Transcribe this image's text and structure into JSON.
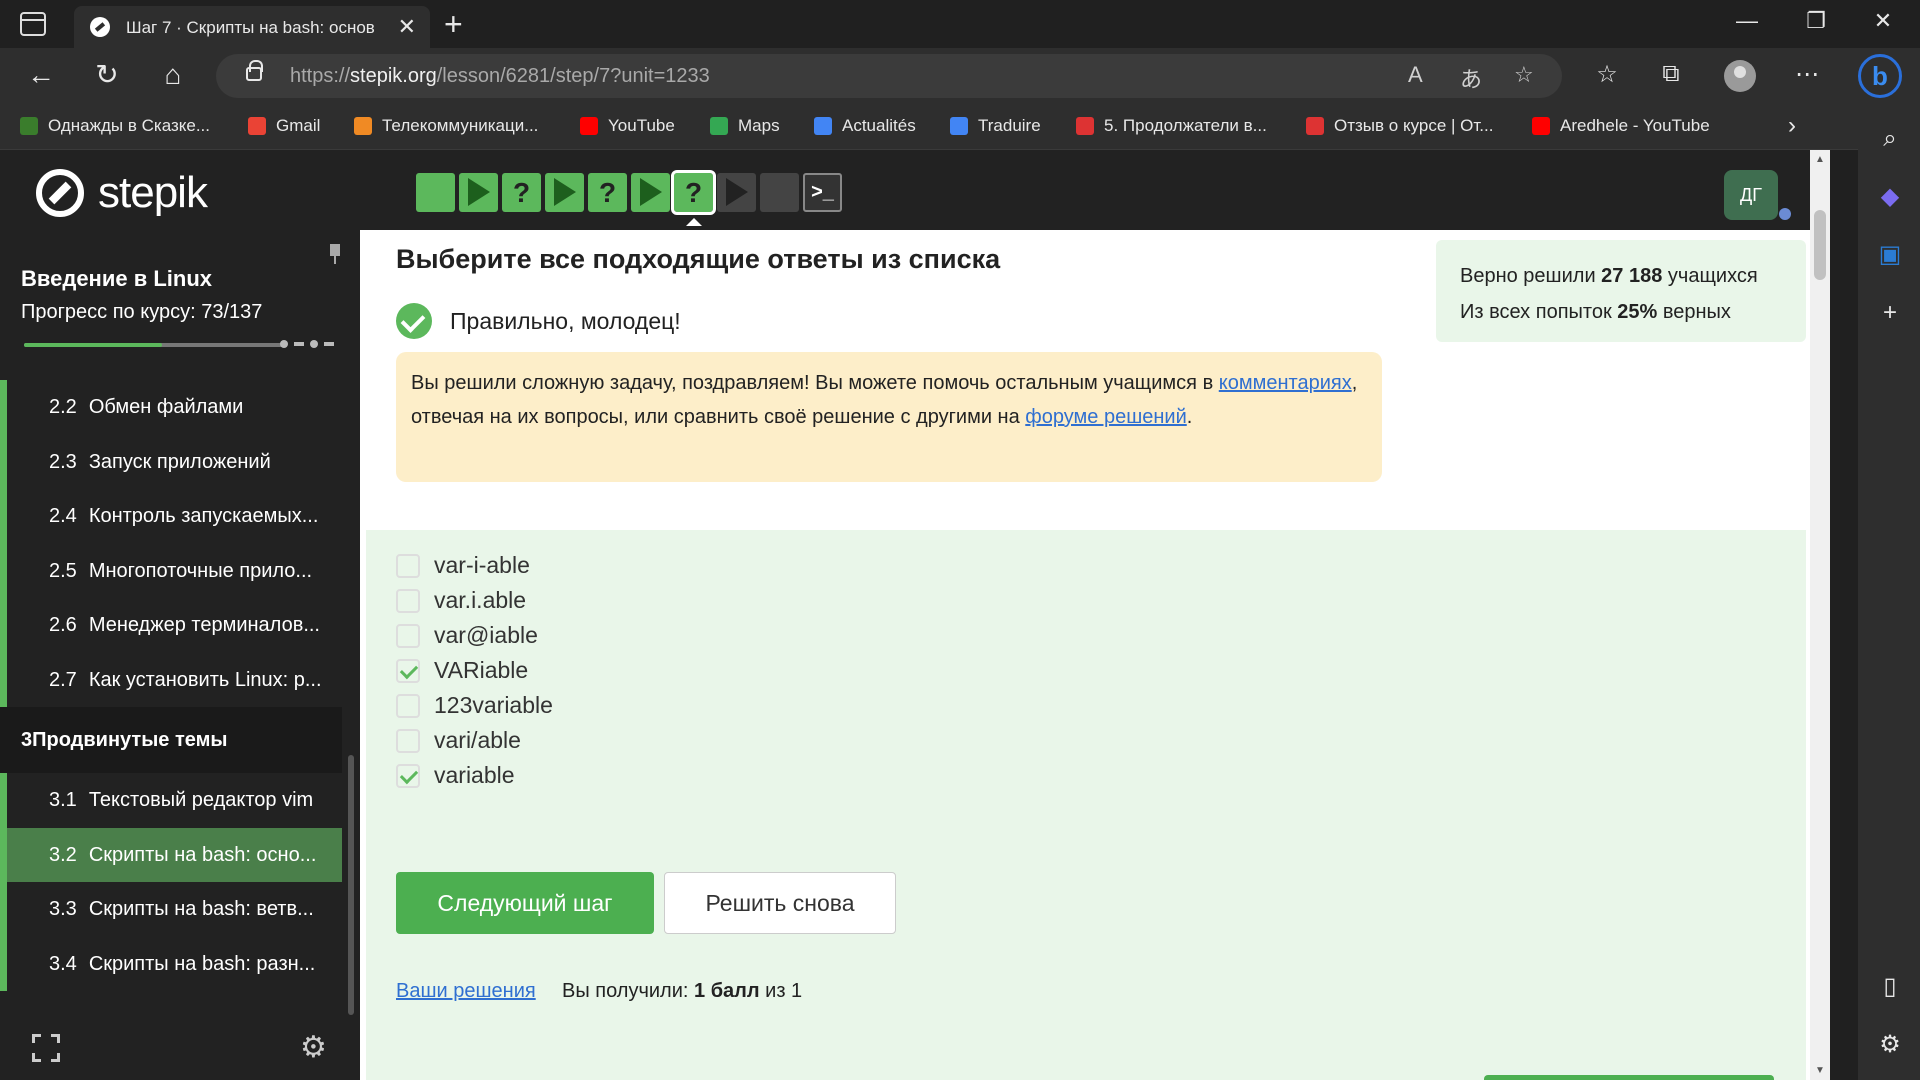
{
  "browser": {
    "tab_title": "Шаг 7 · Скрипты на bash: основ",
    "url_prefix": "https://",
    "url_domain": "stepik.org",
    "url_path": "/lesson/6281/step/7?unit=1233",
    "bookmarks": [
      {
        "label": "Однажды в Сказке...",
        "icon": "hd-icon",
        "color": "#3a7d2c"
      },
      {
        "label": "Gmail",
        "icon": "gmail-icon",
        "color": "#ea4335"
      },
      {
        "label": "Телекоммуникаци...",
        "icon": "telecom-icon",
        "color": "#f08a24"
      },
      {
        "label": "YouTube",
        "icon": "youtube-icon",
        "color": "#ff0000"
      },
      {
        "label": "Maps",
        "icon": "maps-icon",
        "color": "#34a853"
      },
      {
        "label": "Actualités",
        "icon": "news-icon",
        "color": "#4285f4"
      },
      {
        "label": "Traduire",
        "icon": "translate-icon",
        "color": "#4285f4"
      },
      {
        "label": "5. Продолжатели в...",
        "icon": "video-icon",
        "color": "#d33"
      },
      {
        "label": "Отзыв о курсе | От...",
        "icon": "video-icon",
        "color": "#d33"
      },
      {
        "label": "Aredhele - YouTube",
        "icon": "youtube-icon",
        "color": "#ff0000"
      }
    ]
  },
  "sidebar": {
    "course_title": "Введение в Linux",
    "progress_label": "Прогресс по курсу:  73/137",
    "progress_fraction": 0.53,
    "lessons": [
      {
        "num": "2.2",
        "title": "Обмен файлами",
        "type": "lesson"
      },
      {
        "num": "2.3",
        "title": "Запуск приложений",
        "type": "lesson"
      },
      {
        "num": "2.4",
        "title": "Контроль запускаемых...",
        "type": "lesson"
      },
      {
        "num": "2.5",
        "title": "Многопоточные прило...",
        "type": "lesson"
      },
      {
        "num": "2.6",
        "title": "Менеджер терминалов...",
        "type": "lesson"
      },
      {
        "num": "2.7",
        "title": "Как установить Linux: р...",
        "type": "lesson"
      },
      {
        "num": "3",
        "title": "Продвинутые темы",
        "type": "section"
      },
      {
        "num": "3.1",
        "title": "Текстовый редактор vim",
        "type": "lesson"
      },
      {
        "num": "3.2",
        "title": "Скрипты на bash: осно...",
        "type": "active"
      },
      {
        "num": "3.3",
        "title": "Скрипты на bash: ветв...",
        "type": "lesson"
      },
      {
        "num": "3.4",
        "title": "Скрипты на bash: разн...",
        "type": "lesson"
      }
    ]
  },
  "header": {
    "logo_text": "stepik",
    "avatar_initials": "ДГ",
    "steps": [
      {
        "kind": "text",
        "state": "done"
      },
      {
        "kind": "video",
        "state": "done"
      },
      {
        "kind": "quiz",
        "state": "done"
      },
      {
        "kind": "video",
        "state": "done"
      },
      {
        "kind": "quiz",
        "state": "done"
      },
      {
        "kind": "video",
        "state": "done"
      },
      {
        "kind": "quiz",
        "state": "active"
      },
      {
        "kind": "video",
        "state": "todo"
      },
      {
        "kind": "text",
        "state": "todo"
      },
      {
        "kind": "terminal",
        "state": "todo"
      }
    ]
  },
  "quiz": {
    "title": "Выберите все подходящие ответы из списка",
    "correct_message": "Правильно, молодец!",
    "stats_line1_pre": "Верно решили ",
    "stats_line1_num": "27 188",
    "stats_line1_post": " учащихся",
    "stats_line2_pre": "Из всех попыток ",
    "stats_line2_num": "25%",
    "stats_line2_post": " верных",
    "congrats_part1": "Вы решили сложную задачу, поздравляем! Вы можете помочь остальным учащимся в ",
    "congrats_link1": "комментариях",
    "congrats_part2": ", отвечая на их вопросы, или сравнить своё решение с другими на ",
    "congrats_link2": "форуме решений",
    "congrats_part3": ".",
    "options": [
      {
        "label": "var-i-able",
        "checked": false
      },
      {
        "label": "var.i.able",
        "checked": false
      },
      {
        "label": "var@iable",
        "checked": false
      },
      {
        "label": "VARiable",
        "checked": true
      },
      {
        "label": "123variable",
        "checked": false
      },
      {
        "label": "vari/able",
        "checked": false
      },
      {
        "label": "variable",
        "checked": true
      }
    ],
    "next_button": "Следующий шаг",
    "retry_button": "Решить снова",
    "solutions_link": "Ваши решения",
    "score_pre": "Вы получили: ",
    "score_bold": "1 балл",
    "score_post": " из 1"
  },
  "colors": {
    "accent_green": "#5cb85c",
    "button_green": "#4caf50",
    "link_blue": "#2f6fd1",
    "congrats_bg": "#fdeec9",
    "answers_bg": "#e9f6e9"
  }
}
